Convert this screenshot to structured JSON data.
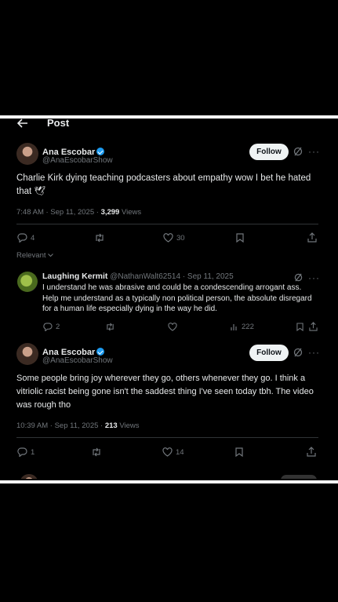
{
  "header": {
    "title": "Post"
  },
  "tweet1": {
    "name": "Ana Escobar",
    "handle": "@AnaEscobarShow",
    "follow": "Follow",
    "text": "Charlie Kirk dying teaching podcasters about empathy wow I bet he hated that",
    "emoji": "🕊",
    "time": "7:48 AM · Sep 11, 2025 · ",
    "views_count": "3,299",
    "views_label": " Views",
    "replies": "4",
    "likes": "30",
    "sort_label": "Relevant"
  },
  "reply": {
    "name": "Laughing Kermit",
    "handle": "@NathanWalt62514 · Sep 11, 2025",
    "text": "I understand he was abrasive and could be a condescending arrogant ass. Help me understand as a typically non political person, the absolute disregard for a human life especially dying in the way he did.",
    "replies": "2",
    "views": "222"
  },
  "tweet2": {
    "name": "Ana Escobar",
    "handle": "@AnaEscobarShow",
    "follow": "Follow",
    "text": "Some people bring joy wherever they go, others whenever they go. I think a vitriolic racist being gone isn't the saddest thing I've seen today tbh. The video was rough tho",
    "time": "10:39 AM · Sep 11, 2025 · ",
    "views_count": "213",
    "views_label": " Views",
    "replies": "1",
    "likes": "14"
  },
  "icons": [
    "back-arrow-icon",
    "verified-icon",
    "grok-icon",
    "more-icon",
    "reply-icon",
    "repost-icon",
    "like-icon",
    "bookmark-icon",
    "share-icon",
    "views-icon",
    "chevron-down-icon"
  ]
}
